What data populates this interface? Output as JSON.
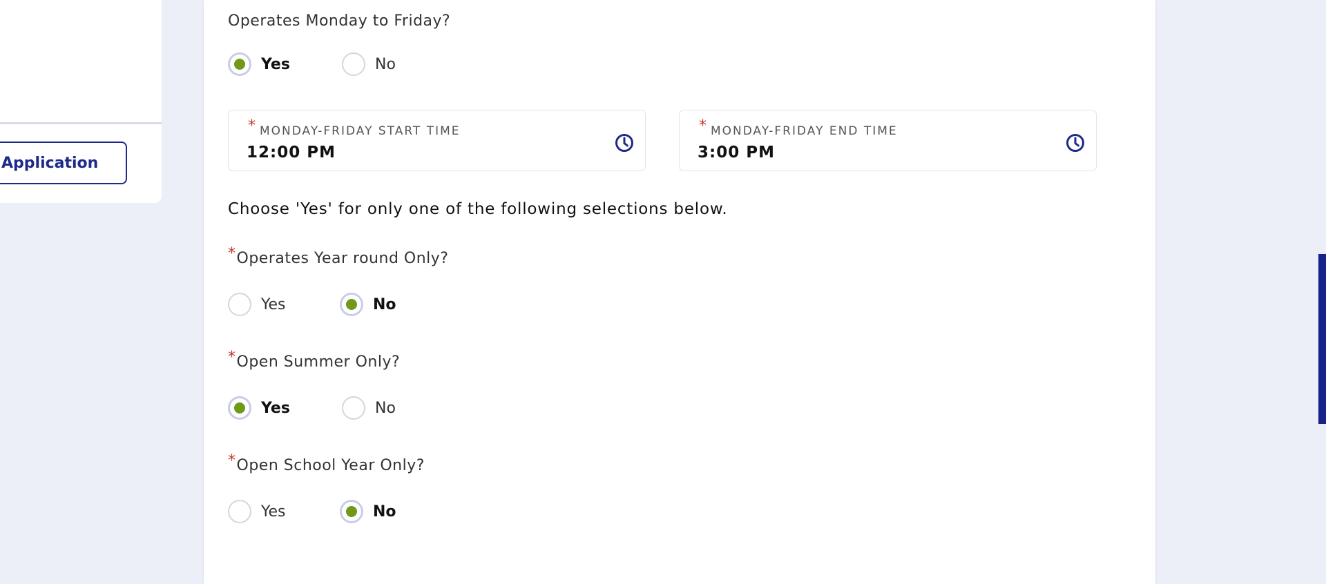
{
  "sidebar": {
    "application_button": "Application"
  },
  "form": {
    "q_weekdays": {
      "label": "Operates Monday to Friday?",
      "options": [
        "Yes",
        "No"
      ],
      "selected": "Yes"
    },
    "start_time": {
      "label": "MONDAY-FRIDAY START TIME",
      "value": "12:00 PM",
      "required": "*"
    },
    "end_time": {
      "label": "MONDAY-FRIDAY END TIME",
      "value": "3:00 PM",
      "required": "*"
    },
    "instructions": "Choose 'Yes' for only one of the following selections below.",
    "q_year_round": {
      "label": "Operates Year round Only?",
      "required": "*",
      "options": [
        "Yes",
        "No"
      ],
      "selected": "No"
    },
    "q_summer": {
      "label": "Open Summer Only?",
      "required": "*",
      "options": [
        "Yes",
        "No"
      ],
      "selected": "Yes"
    },
    "q_school_year": {
      "label": "Open School Year Only?",
      "required": "*",
      "options": [
        "Yes",
        "No"
      ],
      "selected": "No"
    }
  },
  "colors": {
    "accent": "#1d2a8a",
    "radio_selected": "#6e9b16",
    "required": "#c0392b"
  },
  "icons": {
    "time_picker": "clock-icon"
  }
}
